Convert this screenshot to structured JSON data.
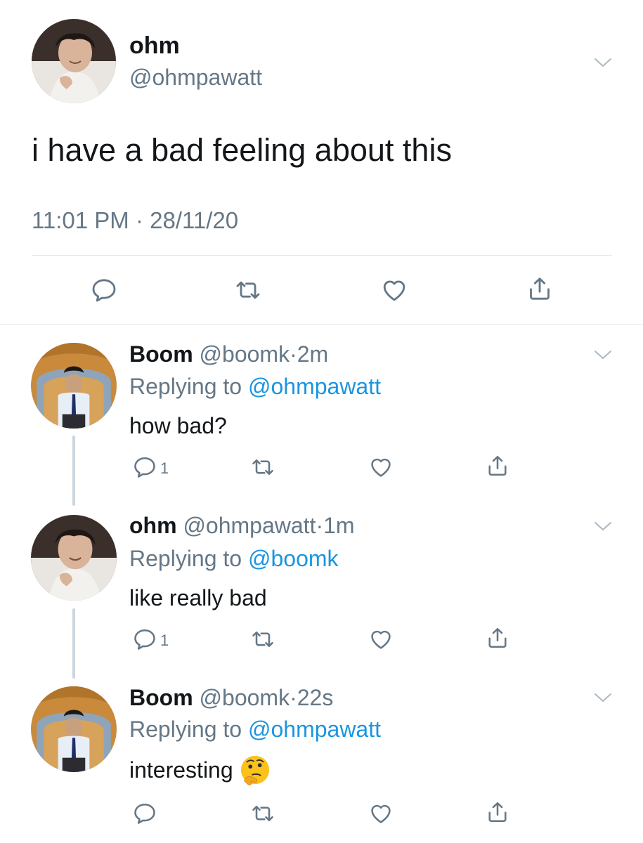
{
  "main_tweet": {
    "display_name": "ohm",
    "handle": "@ohmpawatt",
    "text": "i have a bad feeling about this",
    "timestamp": "11:01 PM · 28/11/20"
  },
  "replies": [
    {
      "display_name": "Boom",
      "handle": "@boomk",
      "separator": "·",
      "age": "2m",
      "replying_label": "Replying to",
      "replying_to": "@ohmpawatt",
      "text": "how bad?",
      "reply_count": "1"
    },
    {
      "display_name": "ohm",
      "handle": "@ohmpawatt",
      "separator": "·",
      "age": "1m",
      "replying_label": "Replying to",
      "replying_to": "@boomk",
      "text": "like really bad",
      "reply_count": "1"
    },
    {
      "display_name": "Boom",
      "handle": "@boomk",
      "separator": "·",
      "age": "22s",
      "replying_label": "Replying to",
      "replying_to": "@ohmpawatt",
      "text": "interesting",
      "emoji": "thinking-face",
      "reply_count": ""
    }
  ],
  "colors": {
    "text": "#14171a",
    "secondary": "#657786",
    "link": "#1b95e0",
    "divider": "#e1e8ed",
    "thread_line": "#ccd6dd"
  },
  "icons": [
    "chevron-down-icon",
    "reply-icon",
    "retweet-icon",
    "like-icon",
    "share-icon"
  ]
}
